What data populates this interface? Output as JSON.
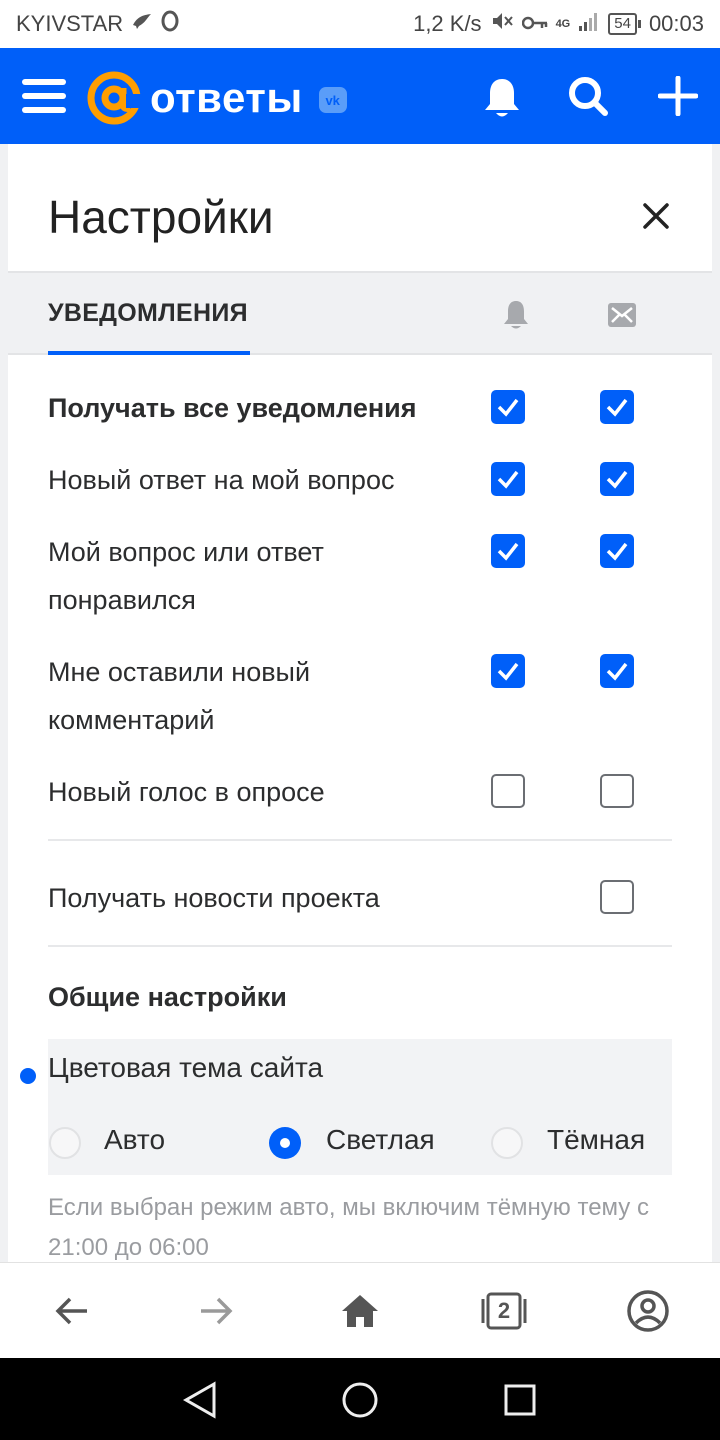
{
  "status_bar": {
    "carrier": "KYIVSTAR",
    "speed": "1,2 K/s",
    "network": "4G",
    "battery": "54",
    "time": "00:03"
  },
  "header": {
    "logo_text": "ответы",
    "badge": "vk",
    "brand_color": "#005ff9"
  },
  "settings": {
    "title": "Настройки",
    "tab_label": "УВЕДОМЛЕНИЯ",
    "columns": [
      "bell-icon",
      "mail-icon"
    ],
    "rows": [
      {
        "label": "Получать все уведомления",
        "bold": true,
        "push": true,
        "email": true
      },
      {
        "label": "Новый ответ на мой вопрос",
        "bold": false,
        "push": true,
        "email": true
      },
      {
        "label": "Мой вопрос или ответ понравился",
        "bold": false,
        "push": true,
        "email": true
      },
      {
        "label": "Мне оставили новый комментарий",
        "bold": false,
        "push": true,
        "email": true
      },
      {
        "label": "Новый голос в опросе",
        "bold": false,
        "push": false,
        "email": false
      }
    ],
    "news_row": {
      "label": "Получать новости проекта",
      "email": false
    },
    "general_title": "Общие настройки",
    "theme": {
      "label": "Цветовая тема сайта",
      "options": [
        "Авто",
        "Светлая",
        "Тёмная"
      ],
      "selected": "Светлая"
    },
    "hint": "Если выбран режим авто, мы включим тёмную тему с 21:00 до 06:00"
  },
  "browser_bar": {
    "tabs_count": "2"
  }
}
